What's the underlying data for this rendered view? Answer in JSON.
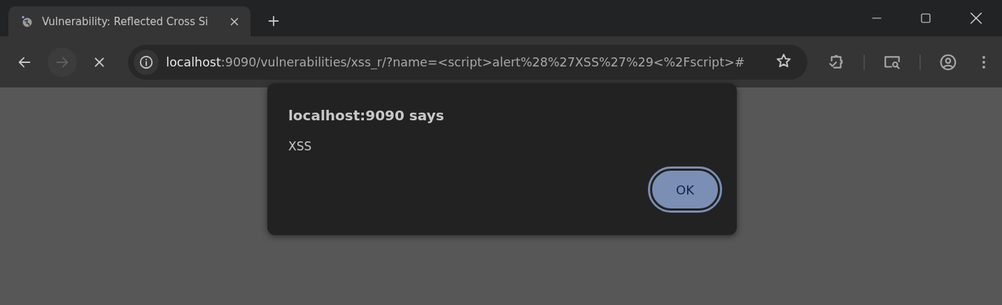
{
  "tabs": [
    {
      "title": "Vulnerability: Reflected Cross Si",
      "selected": true
    }
  ],
  "address_bar": {
    "host": "localhost",
    "path": ":9090/vulnerabilities/xss_r/?name=<script>alert%28%27XSS%27%29<%2Fscript>#"
  },
  "nav": {
    "back_disabled": false,
    "forward_disabled": true
  },
  "dialog": {
    "title": "localhost:9090 says",
    "message": "XSS",
    "buttons": [
      {
        "label": "OK",
        "selected": true
      }
    ]
  }
}
